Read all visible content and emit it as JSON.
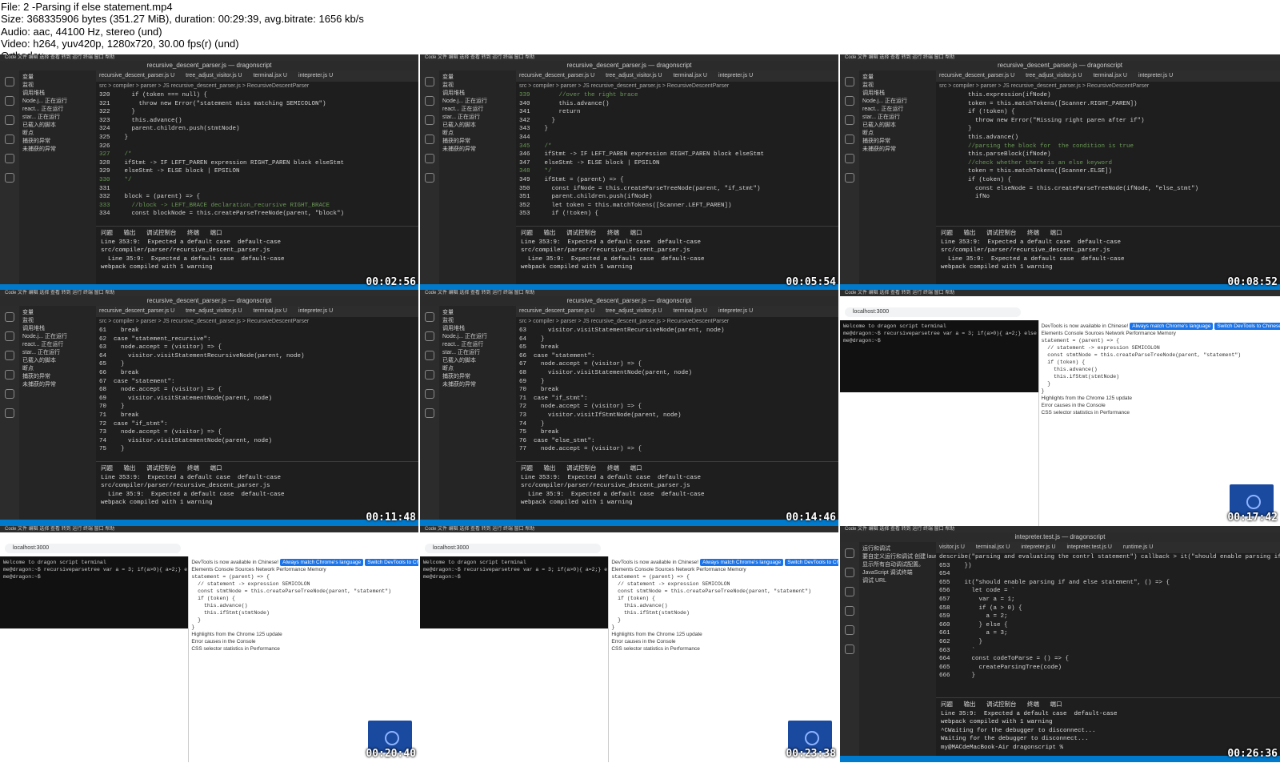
{
  "header": {
    "lines": [
      "File: 2 -Parsing if else statement.mp4",
      "Size: 368335906 bytes (351.27 MiB), duration: 00:29:39, avg.bitrate: 1656 kb/s",
      "Audio: aac, 44100 Hz, stereo (und)",
      "Video: h264, yuv420p, 1280x720, 30.00 fps(r) (und)",
      "Orthodox"
    ]
  },
  "common": {
    "title_bar": "recursive_descent_parser.js — dragonscript",
    "title_bar_test": "intepreter.test.js — dragonscript",
    "tabs": [
      "recursive_descent_parser.js U",
      "tree_adjust_visitor.js U",
      "terminal.jsx U",
      "intepreter.js U"
    ],
    "tabs_test": [
      "visitor.js U",
      "terminal.jsx U",
      "intepreter.js U",
      "intepreter.test.js U",
      "runtime.js U"
    ],
    "crumb": "src > compiler > parser > JS recursive_descent_parser.js > RecursiveDescentParser",
    "sidebar": [
      "变量",
      "监视",
      "调用堆栈",
      "Node.j...  正在运行",
      "react...  正在运行",
      "star...  正在运行",
      "已载入的脚本",
      "断点",
      "捕获的异常",
      "未捕获的异常"
    ],
    "panel_tabs": "问题   输出   调试控制台   终端   端口",
    "panel_lines": [
      "Line 353:9:  Expected a default case  default-case",
      "",
      "src/compiler/parser/recursive_descent_parser.js",
      "  Line 35:9:  Expected a default case  default-case",
      "",
      "webpack compiled with 1 warning"
    ],
    "url": "localhost:3000",
    "terminal_lines": [
      "Welcome to dragon script terminal",
      "me@dragon:~$ recursiveparsetree var a = 3; if(a>0){ a=2;} else {a = 3;}",
      "me@dragon:~$"
    ],
    "devtools_banner": "DevTools is now available in Chinese!",
    "btn_always": "Always match Chrome's language",
    "btn_switch": "Switch DevTools to Chinese",
    "btn_dont": "Don't show again",
    "devtools_tabs": "Elements  Console  Sources  Network  Performance  Memory",
    "whats_new": "Highlights from the Chrome 125 update",
    "err_title": "Error causes in the Console",
    "css_title": "CSS selector statistics in Performance"
  },
  "thumbs": [
    {
      "type": "code",
      "timestamp": "00:02:56",
      "code": [
        "320      if (token === null) {",
        "321        throw new Error(\"statement miss matching SEMICOLON\")",
        "322      }",
        "323      this.advance()",
        "324      parent.children.push(stmtNode)",
        "325    }",
        "326",
        "327    /*",
        "328    ifStmt -> IF LEFT_PAREN expression RIGHT_PAREN block elseStmt",
        "329    elseStmt -> ELSE block | EPSILON",
        "330    */",
        "331",
        "332    block = (parent) => {",
        "333      //block -> LEFT_BRACE declaration_recursive RIGHT_BRACE",
        "334      const blockNode = this.createParseTreeNode(parent, \"block\")",
        "335      parent.children.push(blockNode)"
      ],
      "status": "行 332, 列 4   空格: 4   UTF-8   LF   JavaScript"
    },
    {
      "type": "code",
      "timestamp": "00:05:54",
      "code": [
        "339        //over the right brace",
        "340        this.advance()",
        "341        return",
        "342      }",
        "343    }",
        "344",
        "345    /*",
        "346    ifStmt -> IF LEFT_PAREN expression RIGHT_PAREN block elseStmt",
        "347    elseStmt -> ELSE block | EPSILON",
        "348    */",
        "349    ifStmt = (parent) => {",
        "350      const ifNode = this.createParseTreeNode(parent, \"if_stmt\")",
        "351      parent.children.push(ifNode)",
        "352      let token = this.matchTokens([Scanner.LEFT_PAREN])",
        "353      if (!token) {",
        "354        throw new Error(\"Missing left paren a\")"
      ],
      "status": "行 354, 列 50   空格: 4   UTF-8   LF   JavaScript"
    },
    {
      "type": "code",
      "timestamp": "00:08:52",
      "code": [
        "        this.expression(ifNode)",
        "",
        "        token = this.matchTokens([Scanner.RIGHT_PAREN])",
        "        if (!token) {",
        "          throw new Error(\"Missing right paren after if\")",
        "        }",
        "        this.advance()",
        "",
        "        //parsing the block for  the condition is true",
        "        this.parseBlock(ifNode)",
        "",
        "        //check whether there is an else keyword",
        "        token = this.matchTokens([Scanner.ELSE])",
        "        if (token) {",
        "          const elseNode = this.createParseTreeNode(ifNode, \"else_stmt\")",
        "          ifNo"
      ],
      "status": "行 373, 列 17   空格: 4   UTF-8   LF   JavaScript"
    },
    {
      "type": "code",
      "timestamp": "00:11:48",
      "code": [
        "61    break",
        "62  case \"statement_recursive\":",
        "63    node.accept = (visitor) => {",
        "64      visitor.visitStatementRecursiveNode(parent, node)",
        "65    }",
        "66    break",
        "67  case \"statement\":",
        "68    node.accept = (visitor) => {",
        "69      visitor.visitStatementNode(parent, node)",
        "70    }",
        "71    break",
        "72  case \"if_stmt\":",
        "73    node.accept = (visitor) => {",
        "74      visitor.visitStatementNode(parent, node)",
        "75    }",
        "76  case \"print_stmt\":"
      ],
      "status": "行 73, 列 45   空格: 4   UTF-8   LF   JavaScript"
    },
    {
      "type": "code",
      "timestamp": "00:14:46",
      "code": [
        "63      visitor.visitStatementRecursiveNode(parent, node)",
        "64    }",
        "65    break",
        "66  case \"statement\":",
        "67    node.accept = (visitor) => {",
        "68      visitor.visitStatementNode(parent, node)",
        "69    }",
        "70    break",
        "71  case \"if_stmt\":",
        "72    node.accept = (visitor) => {",
        "73      visitor.visitIfStmtNode(parent, node)",
        "74    }",
        "75    break",
        "76  case \"else_stmt\":",
        "77    node.accept = (visitor) => {",
        "78      visitor.visitElseStmtNode(parent, node)"
      ],
      "status": "行 76, 列 30 (已选择192)   空格: 4   UTF-8   LF   JavaScript"
    },
    {
      "type": "browser",
      "timestamp": "00:17:42"
    },
    {
      "type": "browser",
      "timestamp": "00:20:40"
    },
    {
      "type": "browser",
      "timestamp": "00:23:38"
    },
    {
      "type": "test",
      "timestamp": "00:26:36",
      "code": [
        "describe(\"parsing and evaluating the contrl statement\") callback > it(\"should enable parsing if and else statement\") callback",
        "653    })",
        "654",
        "655    it(\"should enable parsing if and else statement\", () => {",
        "656      let code = `",
        "657        var a = 1;",
        "658        if (a > 0) {",
        "659          a = 2;",
        "660        } else {",
        "661          a = 3;",
        "662        }",
        "663      `",
        "664      const codeToParse = () => {",
        "665        createParsingTree(code)",
        "666      }",
        "667      expect(codeToParse).not.toThrow()",
        "668    })"
      ],
      "run_panel": [
        "运行和调试",
        "要自定义运行和调试 创建 launch.json 文件。",
        "显示所有自动调试配置。",
        "JavaScript 调试终端",
        "调试 URL"
      ],
      "term": [
        "Line 35:9:  Expected a default case  default-case",
        "",
        "webpack compiled with 1 warning",
        "^CWaiting for the debugger to disconnect...",
        "Waiting for the debugger to disconnect...",
        "my@MACdeMacBook-Air dragonscript % "
      ],
      "status": "行 668, 列 42   空格: 4   UTF-8   LF   JavaScript"
    }
  ]
}
